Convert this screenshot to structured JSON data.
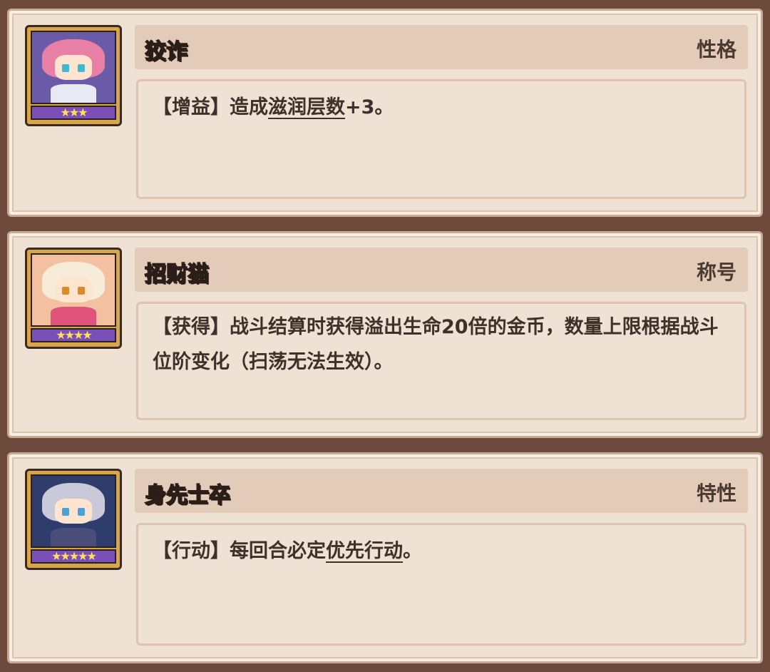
{
  "cards": [
    {
      "name": "狡诈",
      "type": "性格",
      "stars": "★★★",
      "desc_parts": [
        "【增益】造成",
        "滋润层数",
        "+3。"
      ]
    },
    {
      "name": "招财猫",
      "type": "称号",
      "stars": "★★★★",
      "desc_parts": [
        "【获得】战斗结算时获得溢出生命20倍的金币，数量上限根据战斗位阶变化（扫荡无法生效）。"
      ]
    },
    {
      "name": "身先士卒",
      "type": "特性",
      "stars": "★★★★★",
      "desc_parts": [
        "【行动】每回合必定",
        "优先行动",
        "。"
      ]
    }
  ]
}
